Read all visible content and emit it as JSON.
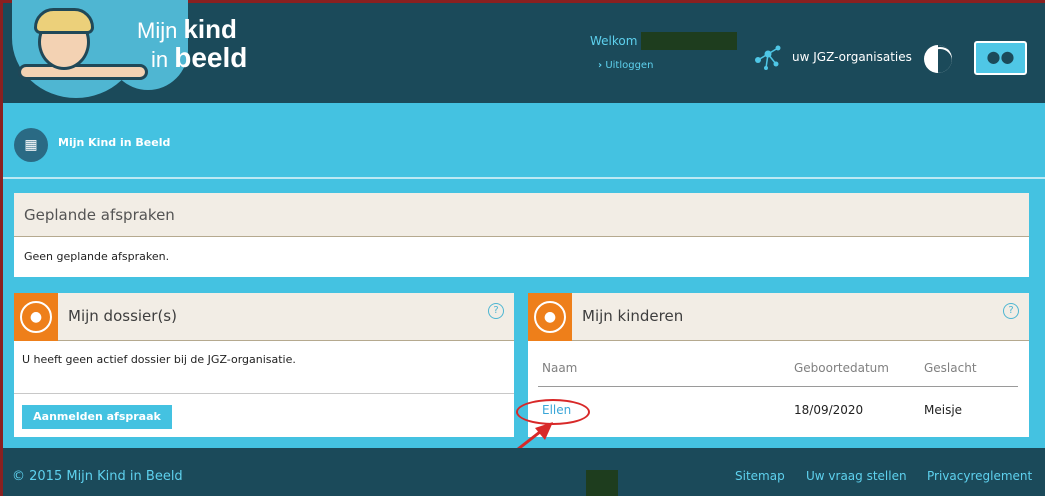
{
  "header": {
    "logo_line1_normal": "Mijn ",
    "logo_line1_bold": "kind",
    "logo_line2_normal": "in ",
    "logo_line2_bold": "beeld",
    "welcome": "Welkom",
    "logout": "Uitloggen",
    "jgz_label": "uw JGZ-organisaties",
    "user_icon": "users-icon",
    "contrast_icon": "contrast-icon"
  },
  "breadcrumb": {
    "icon": "grid-icon",
    "label": "Mijn Kind in Beeld"
  },
  "planned": {
    "title": "Geplande afspraken",
    "message": "Geen geplande afspraken."
  },
  "dossier": {
    "title": "Mijn dossier(s)",
    "message": "U heeft geen actief dossier bij de JGZ-organisatie.",
    "button": "Aanmelden afspraak",
    "help": "?"
  },
  "kinderen": {
    "title": "Mijn kinderen",
    "help": "?",
    "columns": [
      "Naam",
      "Geboortedatum",
      "Geslacht"
    ],
    "rows": [
      {
        "naam": "Ellen",
        "geboortedatum": "18/09/2020",
        "geslacht": "Meisje"
      }
    ]
  },
  "footer": {
    "copyright": "© 2015 Mijn Kind in Beeld",
    "links": [
      "Sitemap",
      "Uw vraag stellen",
      "Privacyreglement"
    ]
  },
  "colors": {
    "header_bg": "#1b4a5a",
    "cyan": "#44c2e1",
    "orange": "#ee7f1a",
    "annotation_red": "#d82828"
  }
}
